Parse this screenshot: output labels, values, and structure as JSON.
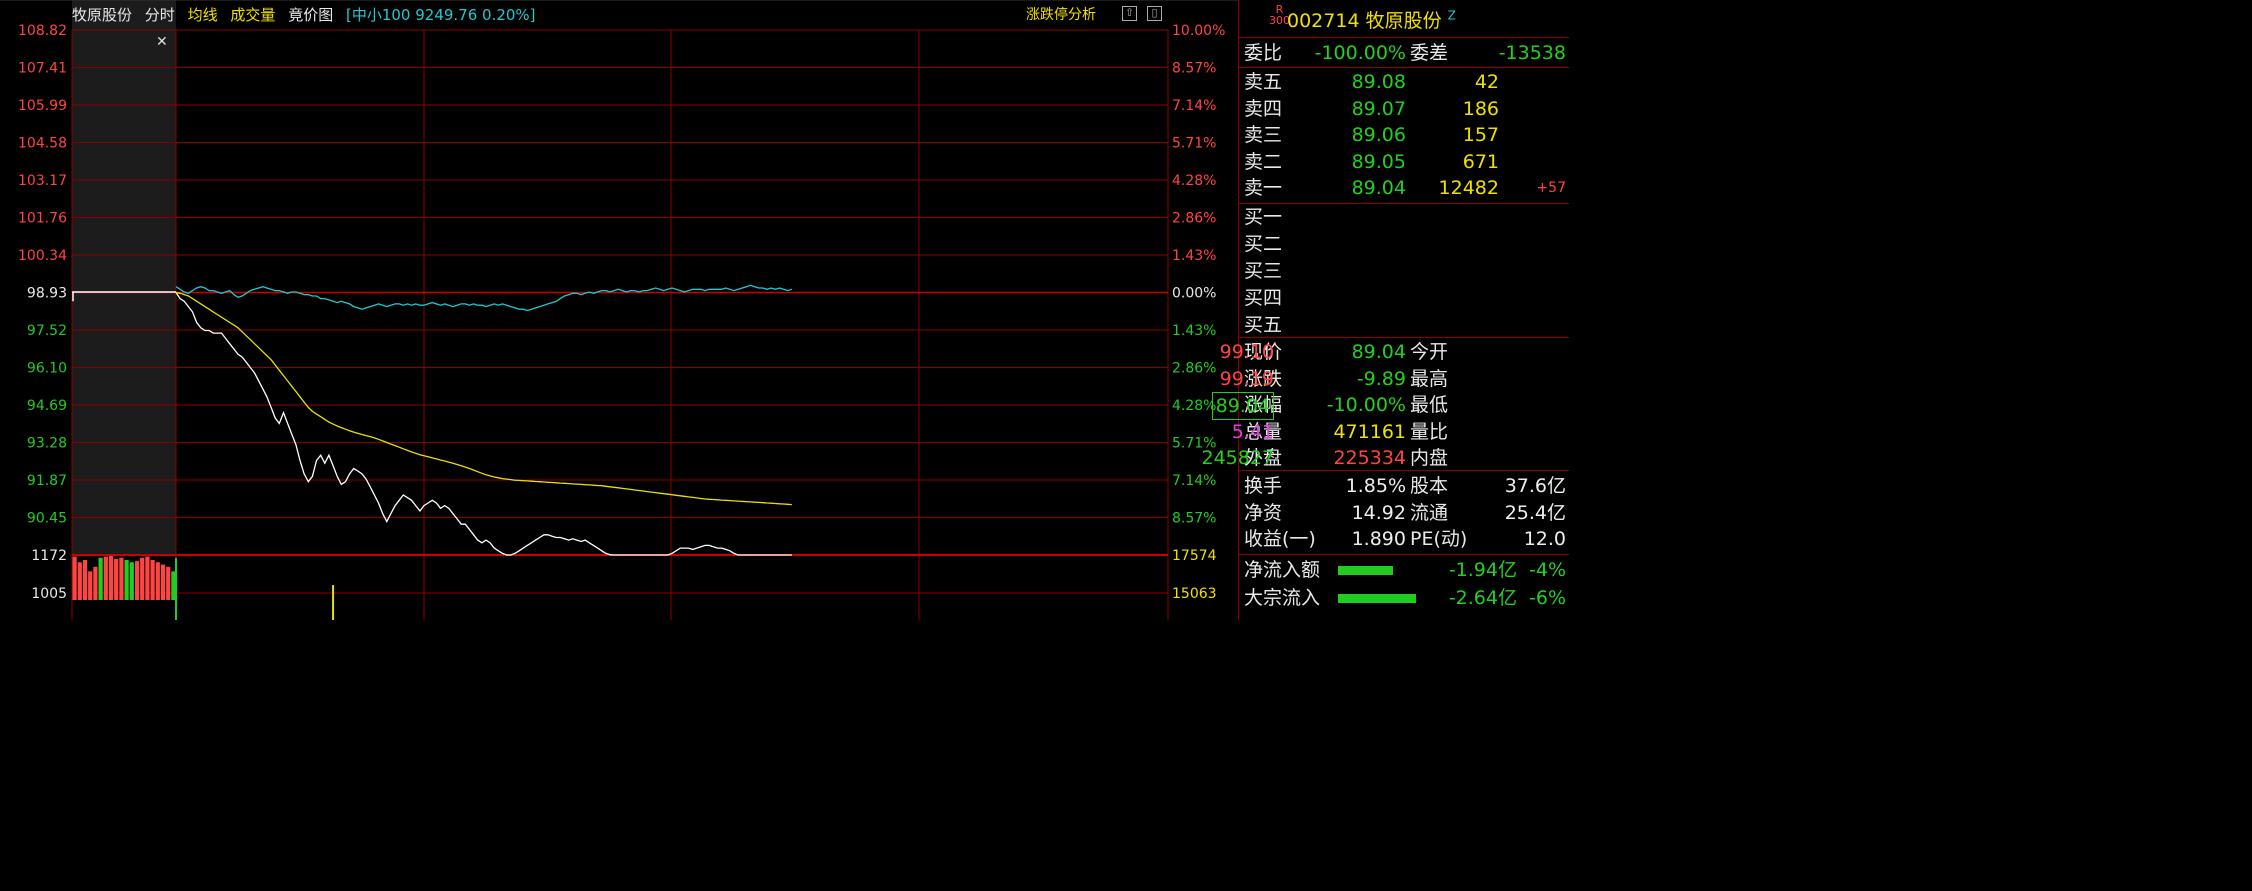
{
  "topbar": {
    "stock_name": "牧原股份",
    "tab_fenshi": "分时",
    "tab_junxian": "均线",
    "tab_chengjiaoliang": "成交量",
    "tab_jingjiatu": "竟价图",
    "index_info": "[中小100 9249.76 0.20%]",
    "zdt_button": "涨跌停分析"
  },
  "colors": {
    "background": "#000000",
    "grid": "#8a0000",
    "price_line": "#ffffff",
    "avg_line": "#e8e000",
    "index_line": "#22c8d0",
    "up": "#ff4444",
    "down": "#22cc22"
  },
  "chart_data": {
    "type": "line",
    "left_ticks": [
      "108.82",
      "107.41",
      "105.99",
      "104.58",
      "103.17",
      "101.76",
      "100.34",
      "98.93",
      "97.52",
      "96.10",
      "94.69",
      "93.28",
      "91.87",
      "90.45"
    ],
    "right_ticks": [
      "10.00%",
      "8.57%",
      "7.14%",
      "5.71%",
      "4.28%",
      "2.86%",
      "1.43%",
      "0.00%",
      "1.43%",
      "2.86%",
      "4.28%",
      "5.71%",
      "7.14%",
      "8.57%"
    ],
    "ylim": [
      89.04,
      108.82
    ],
    "prev_close": 98.93,
    "volume_left_ticks": [
      "1172",
      "1005"
    ],
    "volume_right_ticks": [
      "17574",
      "15063"
    ],
    "x": [
      0,
      1,
      2,
      3,
      4,
      5,
      6,
      7,
      8,
      9,
      10,
      11,
      12,
      13,
      14,
      15,
      16,
      17,
      18,
      19,
      20,
      21,
      22,
      23,
      24,
      25,
      26,
      27,
      28,
      29,
      30,
      31,
      32,
      33,
      34,
      35,
      36,
      37,
      38,
      39,
      40,
      41,
      42,
      43,
      44,
      45,
      46,
      47,
      48,
      49,
      50,
      51,
      52,
      53,
      54,
      55,
      56,
      57,
      58,
      59,
      60,
      61,
      62,
      63,
      64,
      65,
      66,
      67,
      68,
      69,
      70,
      71,
      72,
      73,
      74,
      75,
      76,
      77,
      78,
      79,
      80,
      81,
      82,
      83,
      84,
      85,
      86,
      87,
      88,
      89,
      90,
      91,
      92,
      93,
      94,
      95,
      96,
      97,
      98,
      99,
      100,
      101,
      102,
      103,
      104,
      105,
      106,
      107,
      108,
      109,
      110,
      111,
      112,
      113,
      114,
      115,
      116,
      117,
      118,
      119,
      120,
      121,
      122,
      123,
      124,
      125,
      126,
      127,
      128,
      129,
      130,
      131,
      132,
      133,
      134,
      135,
      136,
      137,
      138,
      139,
      140,
      141,
      142,
      143,
      144,
      145,
      146,
      147,
      148,
      149,
      150,
      151,
      152,
      153,
      154,
      155,
      156,
      157,
      158,
      159,
      160,
      161,
      162,
      163,
      164,
      165,
      166,
      167,
      168,
      169,
      170,
      171,
      172,
      173,
      174,
      175,
      176,
      177,
      178,
      179,
      180,
      181,
      182,
      183,
      184,
      185,
      186,
      187,
      188,
      189,
      190,
      191,
      192,
      193,
      194,
      195,
      196,
      197,
      198,
      199,
      200,
      201,
      202,
      203,
      204,
      205,
      206,
      207,
      208,
      209,
      210,
      211,
      212,
      213,
      214,
      215,
      216,
      217,
      218,
      219,
      220,
      221,
      222,
      223,
      224,
      225,
      226,
      227,
      228,
      229,
      230,
      231,
      232,
      233,
      234,
      235,
      236,
      237,
      238,
      239,
      240
    ],
    "series": [
      {
        "name": "price",
        "values": [
          98.93,
          98.7,
          98.6,
          98.4,
          98.2,
          97.8,
          97.6,
          97.5,
          97.5,
          97.4,
          97.4,
          97.4,
          97.2,
          97.0,
          96.8,
          96.6,
          96.5,
          96.3,
          96.1,
          95.9,
          95.6,
          95.3,
          95.0,
          94.6,
          94.2,
          94.0,
          94.4,
          94.0,
          93.6,
          93.2,
          92.6,
          92.1,
          91.8,
          92.0,
          92.6,
          92.8,
          92.5,
          92.8,
          92.4,
          92.0,
          91.7,
          91.8,
          92.1,
          92.3,
          92.2,
          92.1,
          91.9,
          91.6,
          91.3,
          91.0,
          90.6,
          90.3,
          90.6,
          90.9,
          91.1,
          91.3,
          91.2,
          91.1,
          90.9,
          90.7,
          90.9,
          91.0,
          91.1,
          91.0,
          90.8,
          90.9,
          90.8,
          90.6,
          90.4,
          90.2,
          90.2,
          90.0,
          89.8,
          89.6,
          89.5,
          89.6,
          89.5,
          89.3,
          89.2,
          89.1,
          89.04,
          89.04,
          89.1,
          89.2,
          89.3,
          89.4,
          89.5,
          89.6,
          89.7,
          89.8,
          89.8,
          89.75,
          89.7,
          89.7,
          89.65,
          89.6,
          89.65,
          89.6,
          89.55,
          89.6,
          89.5,
          89.4,
          89.3,
          89.2,
          89.1,
          89.05,
          89.04,
          89.04,
          89.04,
          89.04,
          89.04,
          89.04,
          89.04,
          89.04,
          89.04,
          89.04,
          89.04,
          89.04,
          89.04,
          89.04,
          89.1,
          89.2,
          89.3,
          89.3,
          89.3,
          89.25,
          89.3,
          89.35,
          89.4,
          89.4,
          89.35,
          89.3,
          89.3,
          89.25,
          89.2,
          89.1,
          89.04,
          89.04,
          89.04,
          89.04,
          89.04,
          89.04,
          89.04,
          89.04,
          89.04,
          89.04,
          89.04,
          89.04,
          89.04,
          89.04,
          89.04,
          89.04,
          89.04,
          89.04,
          89.04,
          89.04,
          89.04,
          89.04,
          89.04,
          89.04,
          89.04,
          89.04,
          89.04,
          89.04,
          89.04,
          89.04,
          89.04,
          89.04,
          89.04,
          89.04,
          89.04,
          89.04,
          89.04,
          89.04,
          89.04,
          89.04,
          89.04,
          89.04,
          89.04,
          89.04,
          89.04,
          89.04,
          89.04,
          89.04,
          89.04,
          89.04,
          89.04,
          89.04,
          89.04,
          89.04,
          89.04,
          89.04,
          89.04,
          89.04,
          89.04,
          89.04,
          89.04,
          89.04,
          89.04,
          89.04,
          89.04,
          89.04,
          89.04,
          89.04,
          89.04,
          89.04,
          89.04,
          89.04,
          89.04,
          89.04,
          89.04,
          89.04,
          89.04,
          89.04,
          89.04,
          89.04,
          89.04,
          89.04,
          89.04,
          89.04,
          89.04,
          89.04,
          89.04,
          89.04,
          89.04,
          89.04,
          89.04,
          89.04,
          89.04,
          89.04,
          89.04,
          89.04,
          89.04,
          89.04,
          89.04,
          89.04,
          89.04
        ]
      },
      {
        "name": "avg",
        "values": [
          98.93,
          98.9,
          98.85,
          98.8,
          98.7,
          98.6,
          98.5,
          98.4,
          98.3,
          98.2,
          98.1,
          98.0,
          97.9,
          97.8,
          97.7,
          97.6,
          97.45,
          97.3,
          97.15,
          97.0,
          96.85,
          96.7,
          96.55,
          96.4,
          96.2,
          96.0,
          95.8,
          95.6,
          95.4,
          95.2,
          95.0,
          94.8,
          94.6,
          94.45,
          94.35,
          94.25,
          94.15,
          94.05,
          93.97,
          93.9,
          93.84,
          93.78,
          93.72,
          93.67,
          93.62,
          93.58,
          93.54,
          93.5,
          93.45,
          93.4,
          93.34,
          93.28,
          93.22,
          93.16,
          93.1,
          93.04,
          92.98,
          92.92,
          92.87,
          92.82,
          92.78,
          92.74,
          92.7,
          92.66,
          92.62,
          92.58,
          92.54,
          92.5,
          92.45,
          92.4,
          92.35,
          92.3,
          92.24,
          92.18,
          92.12,
          92.06,
          92.02,
          91.98,
          91.95,
          91.92,
          91.9,
          91.88,
          91.86,
          91.85,
          91.84,
          91.83,
          91.82,
          91.81,
          91.8,
          91.79,
          91.78,
          91.77,
          91.76,
          91.75,
          91.74,
          91.73,
          91.72,
          91.71,
          91.7,
          91.69,
          91.68,
          91.67,
          91.66,
          91.65,
          91.63,
          91.61,
          91.59,
          91.57,
          91.55,
          91.53,
          91.51,
          91.49,
          91.47,
          91.45,
          91.43,
          91.41,
          91.39,
          91.37,
          91.35,
          91.33,
          91.31,
          91.29,
          91.27,
          91.25,
          91.23,
          91.21,
          91.19,
          91.17,
          91.15,
          91.14,
          91.13,
          91.12,
          91.11,
          91.1,
          91.09,
          91.08,
          91.07,
          91.06,
          91.05,
          91.04,
          91.03,
          91.02,
          91.01,
          91.0,
          90.99,
          90.98,
          90.97,
          90.96,
          90.95,
          90.94,
          90.93,
          90.92,
          90.91,
          90.9,
          90.89,
          90.88,
          90.87,
          90.86,
          90.85,
          90.84,
          90.83,
          90.82,
          90.81,
          90.8,
          90.79,
          90.78,
          90.77,
          90.76,
          90.75,
          90.74,
          90.73,
          90.72,
          90.71,
          90.7,
          90.69,
          90.68,
          90.67,
          90.66,
          90.65,
          90.64,
          90.63,
          90.62,
          90.61,
          90.6,
          90.59,
          90.58,
          90.57,
          90.56,
          90.55,
          90.54,
          90.53,
          90.52,
          90.51,
          90.5,
          90.49,
          90.48,
          90.47,
          90.46,
          90.45,
          90.44,
          90.43,
          90.42,
          90.41,
          90.4,
          90.39,
          90.38,
          90.37,
          90.36,
          90.35,
          90.34,
          90.33,
          90.32,
          90.31,
          90.3,
          90.29,
          90.28,
          90.27,
          90.26,
          90.25,
          90.24,
          90.23,
          90.22,
          90.21,
          90.2,
          90.19,
          90.18,
          90.17,
          90.16,
          90.15,
          90.14,
          90.13,
          90.12,
          90.11,
          90.1,
          90.09,
          90.08,
          90.07,
          90.06,
          90.05,
          90.04,
          90.03,
          90.02,
          90.01
        ]
      },
      {
        "name": "index",
        "values": [
          99.15,
          99.05,
          98.95,
          98.9,
          99.0,
          99.1,
          99.15,
          99.1,
          99.0,
          99.0,
          98.95,
          98.9,
          98.95,
          99.0,
          98.85,
          98.75,
          98.8,
          98.9,
          99.0,
          99.05,
          99.1,
          99.15,
          99.1,
          99.05,
          99.0,
          99.0,
          98.95,
          98.9,
          98.95,
          98.95,
          98.9,
          98.85,
          98.85,
          98.8,
          98.8,
          98.7,
          98.7,
          98.65,
          98.6,
          98.55,
          98.6,
          98.55,
          98.5,
          98.4,
          98.35,
          98.3,
          98.35,
          98.4,
          98.45,
          98.5,
          98.45,
          98.4,
          98.45,
          98.5,
          98.5,
          98.45,
          98.5,
          98.45,
          98.5,
          98.45,
          98.45,
          98.5,
          98.55,
          98.5,
          98.45,
          98.5,
          98.45,
          98.4,
          98.45,
          98.5,
          98.5,
          98.45,
          98.5,
          98.45,
          98.45,
          98.4,
          98.45,
          98.5,
          98.45,
          98.5,
          98.45,
          98.4,
          98.35,
          98.3,
          98.3,
          98.25,
          98.3,
          98.35,
          98.4,
          98.45,
          98.5,
          98.55,
          98.6,
          98.7,
          98.8,
          98.85,
          98.9,
          98.9,
          98.85,
          98.9,
          98.95,
          98.9,
          98.95,
          99.0,
          99.0,
          98.95,
          99.0,
          99.05,
          99.0,
          98.95,
          99.0,
          99.0,
          98.95,
          99.0,
          99.0,
          99.05,
          99.1,
          99.05,
          99.0,
          99.05,
          99.1,
          99.05,
          99.0,
          98.95,
          99.0,
          99.05,
          99.05,
          99.05,
          99.0,
          99.05,
          99.05,
          99.05,
          99.05,
          99.1,
          99.05,
          99.0,
          99.05,
          99.1,
          99.15,
          99.2,
          99.15,
          99.1,
          99.1,
          99.05,
          99.1,
          99.05,
          99.1,
          99.05,
          99.0,
          99.05,
          99.1,
          99.05,
          99.05,
          99.0,
          99.05,
          99.05,
          99.05,
          99.1,
          99.1,
          99.05,
          99.0,
          99.05,
          99.05,
          99.05,
          99.05,
          99.05,
          99.05,
          99.05,
          99.05,
          99.05,
          99.05,
          99.05,
          99.05,
          99.05,
          99.05,
          99.05,
          99.05,
          99.05,
          99.05,
          99.05,
          99.05,
          99.05,
          99.05,
          99.05,
          99.05,
          99.05,
          99.05,
          99.05,
          99.05,
          99.05,
          99.05,
          99.05,
          99.05,
          99.05,
          99.05,
          99.05,
          99.05,
          99.05,
          99.05,
          99.05,
          99.05,
          99.05,
          99.05,
          99.05,
          99.05,
          99.05,
          99.05,
          99.05,
          99.05,
          99.05,
          99.05,
          99.05,
          99.05,
          99.05,
          99.05,
          99.05,
          99.05,
          99.05,
          99.05,
          99.05,
          99.05,
          99.05,
          99.05,
          99.05,
          99.05,
          99.05,
          99.05,
          99.05,
          99.05,
          99.05,
          99.05,
          99.05,
          99.05,
          99.05,
          99.05,
          99.05,
          99.05,
          99.05,
          99.05,
          99.05,
          99.05,
          99.05,
          99.05
        ]
      }
    ],
    "auction_volume": [
      1165,
      1140,
      1150,
      1100,
      1120,
      1160,
      1165,
      1168,
      1155,
      1160,
      1150,
      1140,
      1145,
      1160,
      1165,
      1150,
      1140,
      1130,
      1120,
      1100
    ],
    "auction_colors": [
      "red",
      "red",
      "red",
      "red",
      "red",
      "green",
      "red",
      "red",
      "red",
      "red",
      "green",
      "green",
      "red",
      "red",
      "red",
      "red",
      "red",
      "red",
      "red",
      "green"
    ],
    "volume_spikes": [
      {
        "x": 0,
        "value": 1160,
        "color": "green"
      },
      {
        "x": 38,
        "value": 1040,
        "color": "yellow"
      }
    ]
  },
  "quote": {
    "badge_top": "R",
    "badge_bottom": "300",
    "code": "002714",
    "name": "牧原股份",
    "suffix": "Z",
    "weibi_label": "委比",
    "weibi": "-100.00%",
    "weicha_label": "委差",
    "weicha": "-13538",
    "asks": [
      {
        "label": "卖五",
        "price": "89.08",
        "vol": "42",
        "chg": ""
      },
      {
        "label": "卖四",
        "price": "89.07",
        "vol": "186",
        "chg": ""
      },
      {
        "label": "卖三",
        "price": "89.06",
        "vol": "157",
        "chg": ""
      },
      {
        "label": "卖二",
        "price": "89.05",
        "vol": "671",
        "chg": ""
      },
      {
        "label": "卖一",
        "price": "89.04",
        "vol": "12482",
        "chg": "+57"
      }
    ],
    "bids": [
      {
        "label": "买一"
      },
      {
        "label": "买二"
      },
      {
        "label": "买三"
      },
      {
        "label": "买四"
      },
      {
        "label": "买五"
      }
    ],
    "stats1": [
      {
        "l1": "现价",
        "v1": "89.04",
        "c1": "green",
        "l2": "今开",
        "v2": "99.10",
        "c2": "red"
      },
      {
        "l1": "涨跌",
        "v1": "-9.89",
        "c1": "green",
        "l2": "最高",
        "v2": "99.19",
        "c2": "red"
      },
      {
        "l1": "涨幅",
        "v1": "-10.00%",
        "c1": "green",
        "l2": "最低",
        "v2": "89.04",
        "c2": "green"
      },
      {
        "l1": "总量",
        "v1": "471161",
        "c1": "yellow",
        "l2": "量比",
        "v2": "5.41",
        "c2": "magenta"
      },
      {
        "l1": "外盘",
        "v1": "225334",
        "c1": "red",
        "l2": "内盘",
        "v2": "245827",
        "c2": "green"
      }
    ],
    "stats2": [
      {
        "l1": "换手",
        "v1": "1.85%",
        "l2": "股本",
        "v2": "37.6亿"
      },
      {
        "l1": "净资",
        "v1": "14.92",
        "l2": "流通",
        "v2": "25.4亿"
      },
      {
        "l1": "收益(一)",
        "v1": "1.890",
        "l2": "PE(动)",
        "v2": "12.0"
      }
    ],
    "flows": [
      {
        "label": "净流入额",
        "fraction": 0.55,
        "amount": "-1.94亿",
        "pct": "-4%"
      },
      {
        "label": "大宗流入",
        "fraction": 0.78,
        "amount": "-2.64亿",
        "pct": "-6%"
      }
    ]
  }
}
